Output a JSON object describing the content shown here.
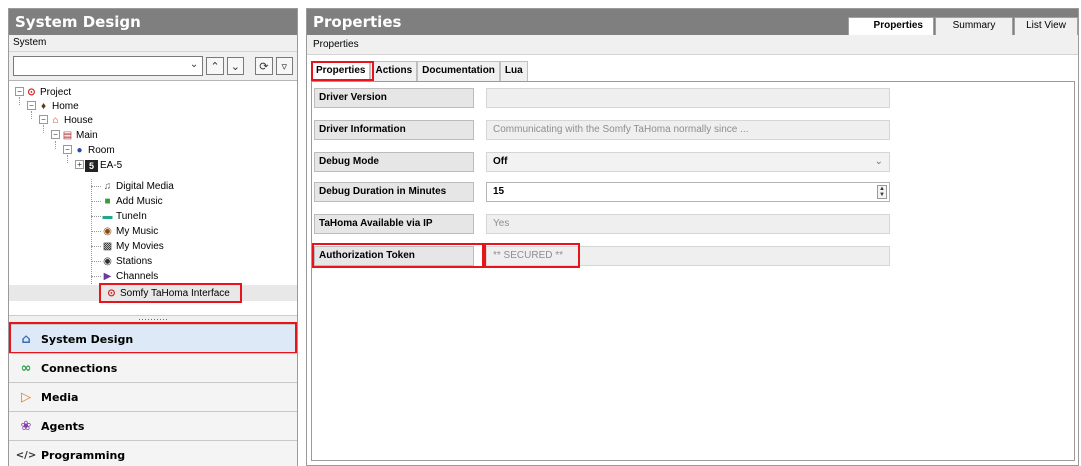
{
  "left_panel": {
    "title": "System Design",
    "sub_label": "System",
    "tree": [
      {
        "label": "Project",
        "icon": "project-icon"
      },
      {
        "label": "Home",
        "icon": "home-icon"
      },
      {
        "label": "House",
        "icon": "house-icon"
      },
      {
        "label": "Main",
        "icon": "floor-icon"
      },
      {
        "label": "Room",
        "icon": "room-icon"
      },
      {
        "label": "EA-5",
        "icon": "controller-icon"
      },
      {
        "label": "Digital Media",
        "icon": "digital-media-icon"
      },
      {
        "label": "Add Music",
        "icon": "add-music-icon"
      },
      {
        "label": "TuneIn",
        "icon": "tunein-icon"
      },
      {
        "label": "My Music",
        "icon": "my-music-icon"
      },
      {
        "label": "My Movies",
        "icon": "my-movies-icon"
      },
      {
        "label": "Stations",
        "icon": "stations-icon"
      },
      {
        "label": "Channels",
        "icon": "channels-icon"
      },
      {
        "label": "Somfy TaHoma Interface",
        "icon": "driver-icon"
      }
    ],
    "splitter": "··········",
    "nav": [
      {
        "label": "System Design",
        "icon": "home-outline-icon",
        "color": "#3b6fb6"
      },
      {
        "label": "Connections",
        "icon": "link-icon",
        "color": "#2e9e4f"
      },
      {
        "label": "Media",
        "icon": "play-icon",
        "color": "#e07b1a"
      },
      {
        "label": "Agents",
        "icon": "agents-icon",
        "color": "#8a3fb0"
      },
      {
        "label": "Programming",
        "icon": "code-icon",
        "color": "#333333"
      }
    ]
  },
  "right_panel": {
    "title": "Properties",
    "view_tabs": [
      "Properties",
      "Summary",
      "List View"
    ],
    "section_label": "Properties",
    "inner_tabs": [
      "Properties",
      "Actions",
      "Documentation",
      "Lua"
    ],
    "properties": [
      {
        "label": "Driver Version",
        "value": ""
      },
      {
        "label": "Driver Information",
        "value": "Communicating with the Somfy TaHoma normally since ..."
      },
      {
        "label": "Debug Mode",
        "value": "Off"
      },
      {
        "label": "Debug Duration in Minutes",
        "value": "15"
      },
      {
        "label": "TaHoma Available via IP",
        "value": "Yes"
      },
      {
        "label": "Authorization Token",
        "value": "** SECURED **"
      }
    ]
  },
  "colors": {
    "header_bg": "#7f7f7f",
    "highlight_red": "#e8141c"
  }
}
